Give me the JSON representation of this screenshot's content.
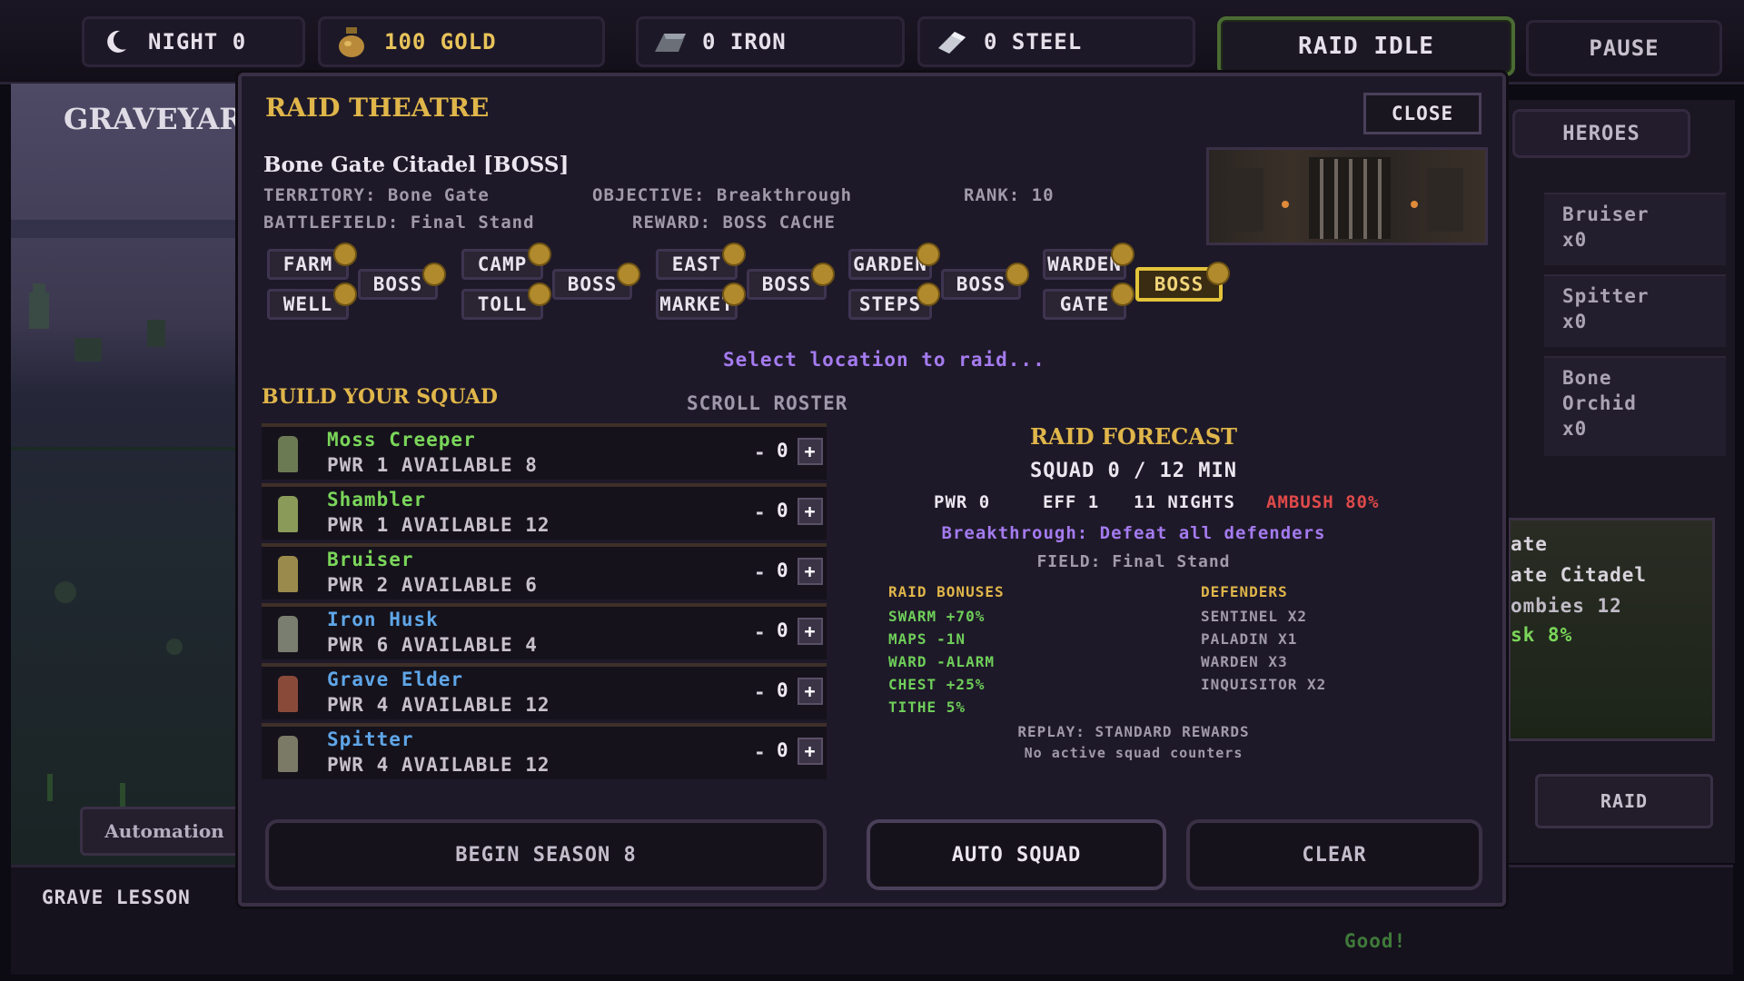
{
  "topbar": {
    "night": "NIGHT 0",
    "gold": "100 GOLD",
    "iron": "0 IRON",
    "steel": "0 STEEL",
    "raid_status": "RAID IDLE",
    "pause": "PAUSE"
  },
  "world": {
    "title": "GRAVEYARD",
    "automation": "Automation"
  },
  "side": {
    "heroes_tab": "HEROES",
    "heroes": [
      {
        "name": "Bruiser",
        "count": "x0"
      },
      {
        "name": "Spitter",
        "count": "x0"
      },
      {
        "name": "Bone Orchid",
        "count": "x0"
      }
    ],
    "card_line1": "ate",
    "card_line2": "ate Citadel",
    "card_line3": "ombies  12",
    "card_line4": "sk  8%",
    "raid_button": "RAID"
  },
  "bottom": {
    "lesson": "GRAVE LESSON",
    "good": "Good!"
  },
  "modal": {
    "title": "RAID THEATRE",
    "close": "CLOSE",
    "location_name": "Bone Gate Citadel  [BOSS]",
    "territory": "TERRITORY: Bone Gate",
    "objective": "OBJECTIVE: Breakthrough",
    "rank": "RANK: 10",
    "battlefield": "BATTLEFIELD: Final Stand",
    "reward": "REWARD: BOSS CACHE",
    "locations": {
      "farm": "FARM",
      "well": "WELL",
      "boss1": "BOSS",
      "camp": "CAMP",
      "toll": "TOLL",
      "boss2": "BOSS",
      "east": "EAST",
      "market": "MARKET",
      "boss3": "BOSS",
      "garden": "GARDEN",
      "steps": "STEPS",
      "boss4": "BOSS",
      "warden": "WARDEN",
      "gate": "GATE",
      "boss5": "BOSS"
    },
    "prompt": "Select location to raid...",
    "build_squad": "BUILD YOUR SQUAD",
    "scroll_roster": "SCROLL ROSTER",
    "units": [
      {
        "name": "Moss Creeper",
        "stats": "PWR 1   AVAILABLE 8",
        "qty": "0",
        "color": "#7ad65a"
      },
      {
        "name": "Shambler",
        "stats": "PWR 1   AVAILABLE 12",
        "qty": "0",
        "color": "#7ad65a"
      },
      {
        "name": "Bruiser",
        "stats": "PWR 2   AVAILABLE 6",
        "qty": "0",
        "color": "#7ad65a"
      },
      {
        "name": "Iron Husk",
        "stats": "PWR 6   AVAILABLE 4",
        "qty": "0",
        "color": "#5fa6e8"
      },
      {
        "name": "Grave Elder",
        "stats": "PWR 4   AVAILABLE 12",
        "qty": "0",
        "color": "#5fa6e8"
      },
      {
        "name": "Spitter",
        "stats": "PWR 4   AVAILABLE 12",
        "qty": "0",
        "color": "#5fa6e8"
      }
    ],
    "forecast": {
      "title": "RAID FORECAST",
      "squad": "SQUAD 0 / 12 MIN",
      "pwr": "PWR 0",
      "eff": "EFF 1",
      "nights": "11 NIGHTS",
      "ambush": "AMBUSH 80%",
      "objective": "Breakthrough: Defeat all defenders",
      "field": "FIELD: Final Stand",
      "bonuses_title": "RAID BONUSES",
      "bonuses": [
        "SWARM +70%",
        "MAPS -1N",
        "WARD -ALARM",
        "CHEST +25%",
        "TITHE 5%"
      ],
      "defenders_title": "DEFENDERS",
      "defenders": [
        "SENTINEL X2",
        "PALADIN X1",
        "WARDEN X3",
        "INQUISITOR X2"
      ],
      "replay": "REPLAY: STANDARD REWARDS",
      "counters": "No active squad counters"
    },
    "buttons": {
      "begin": "BEGIN SEASON 8",
      "auto": "AUTO SQUAD",
      "clear": "CLEAR"
    }
  }
}
